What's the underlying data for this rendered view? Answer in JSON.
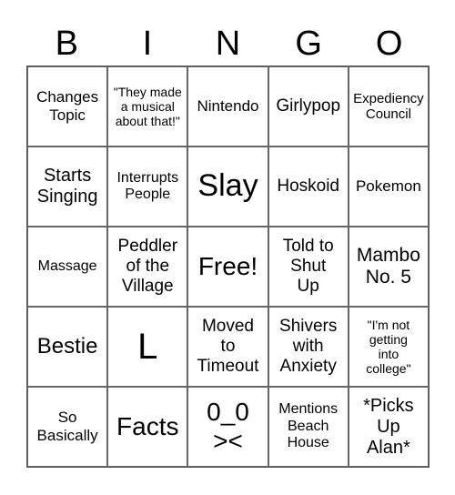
{
  "header": [
    "B",
    "I",
    "N",
    "G",
    "O"
  ],
  "cells": [
    [
      "Changes\nTopic",
      "\"They made\na musical\nabout that!\"",
      "Nintendo",
      "Girlypop",
      "Expediency\nCouncil"
    ],
    [
      "Starts\nSinging",
      "Interrupts\nPeople",
      "Slay",
      "Hoskoid",
      "Pokemon"
    ],
    [
      "Massage",
      "Peddler\nof the\nVillage",
      "Free!",
      "Told to\nShut\nUp",
      "Mambo\nNo. 5"
    ],
    [
      "Bestie",
      "L",
      "Moved\nto\nTimeout",
      "Shivers\nwith\nAnxiety",
      "\"I'm not\ngetting\ninto\ncollege\""
    ],
    [
      "So\nBasically",
      "Facts",
      "0_0\n><",
      "Mentions\nBeach\nHouse",
      "*Picks\nUp\nAlan*"
    ]
  ]
}
